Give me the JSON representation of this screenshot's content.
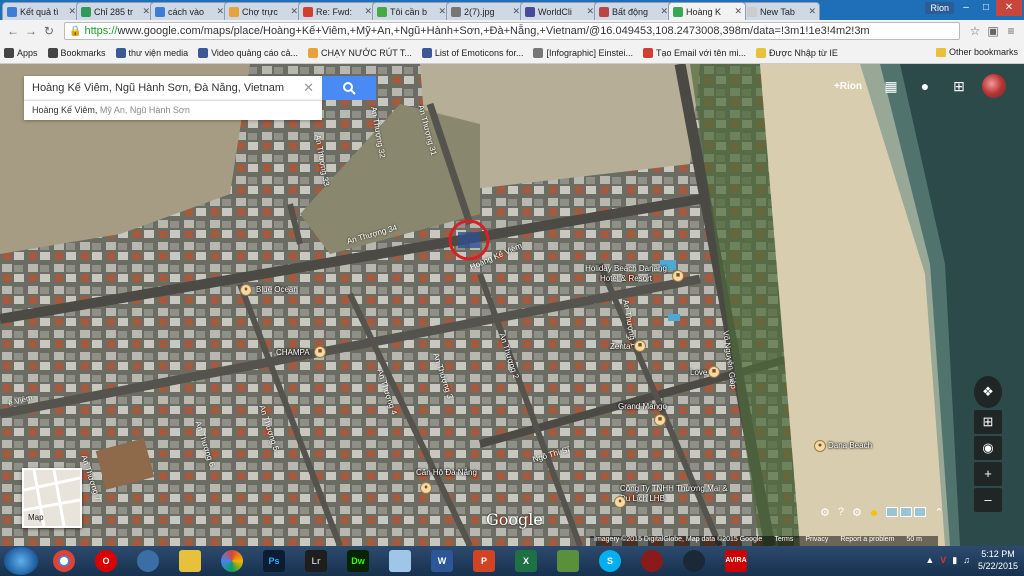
{
  "tabs": [
    {
      "title": "Kết quả tì",
      "color": "#3b7dd8"
    },
    {
      "title": "Chỉ 285 tr",
      "color": "#2f9a5c"
    },
    {
      "title": "cách vào",
      "color": "#3b7dd8"
    },
    {
      "title": "Chợ trực",
      "color": "#e7a23c"
    },
    {
      "title": "Re: Fwd:",
      "color": "#d23f31"
    },
    {
      "title": "Tôi cần b",
      "color": "#44aa44"
    },
    {
      "title": "2(7).jpg",
      "color": "#777777"
    },
    {
      "title": "WorldCli",
      "color": "#4a4a9a"
    },
    {
      "title": "Bất động",
      "color": "#b44"
    },
    {
      "title": "Hoàng K",
      "color": "#34a853",
      "active": true
    },
    {
      "title": "New Tab",
      "color": "#cccccc"
    }
  ],
  "window": {
    "user": "Rion"
  },
  "toolbar": {
    "url_scheme": "https://",
    "url_rest": "www.google.com/maps/place/Hoàng+Kế+Viêm,+Mỹ+An,+Ngũ+Hành+Sơn,+Đà+Nẵng,+Vietnam/@16.049453,108.2473008,398m/data=!3m1!1e3!4m2!3m"
  },
  "bookmarks": [
    {
      "label": "Apps",
      "color": "#444"
    },
    {
      "label": "Bookmarks",
      "color": "#444"
    },
    {
      "label": "thư viện media",
      "color": "#3b5998"
    },
    {
      "label": "Video quảng cáo cả...",
      "color": "#3b5998"
    },
    {
      "label": "CHẠY NƯỚC RÚT T...",
      "color": "#e7a23c"
    },
    {
      "label": "List of Emoticons for...",
      "color": "#3b5998"
    },
    {
      "label": "[Infographic] Einstei...",
      "color": "#777"
    },
    {
      "label": "Tạo Email với tên mi...",
      "color": "#d23f31"
    },
    {
      "label": "Được Nhập từ IE",
      "color": "#e7c13c"
    }
  ],
  "bookmarks_other": "Other bookmarks",
  "maps": {
    "search_value": "Hoàng Kế Viêm, Ngũ Hành Sơn, Đà Nẵng, Vietnam",
    "suggest_main": "Hoàng Kế Viêm, ",
    "suggest_sub": "Mỹ An, Ngũ Hành Sơn",
    "user": "+Rion",
    "minimap_label": "Map",
    "google_logo": "Google",
    "attribution": [
      "Imagery ©2015 DigitalGlobe, Map data ©2015 Google",
      "Terms",
      "Privacy",
      "Report a problem",
      "50 m"
    ],
    "streets": {
      "an_thuong_31": "An Thượng 31",
      "an_thuong_32": "An Thượng 32",
      "an_thuong_33": "An Thượng 33",
      "an_thuong_34": "An Thượng 34",
      "hoang_ke_viem": "Hoàng Kế Viêm",
      "an_thuong_1": "An Thượng 1",
      "an_thuong_2": "An Thượng 2",
      "an_thuong_3": "An Thượng 3",
      "an_thuong_4": "An Thượng 4",
      "an_thuong_5": "An Thượng 5",
      "an_thuong_6": "An Thượng 6",
      "an_thuong_7": "An Thượng 7",
      "ngo_thi_si": "Ngô Thì Sĩ",
      "vo_nguyen_giap": "Võ Nguyên Giáp",
      "viem_left": "ế Viêm"
    },
    "pois": {
      "holiday_beach": "Holiday Beach Danang Hotel & Resort",
      "blue_ocean": "Blue Ocean",
      "champa": "CHAMPA",
      "zenta": "Zenta",
      "love": "Love",
      "grand_mango": "Grand Mango",
      "can_ho": "Căn Hộ Đà Nẵng",
      "cong_ty": "Công Ty TNHH Thương Mại & Du Lịch LHB",
      "dana_beach": "Dana Beach"
    }
  },
  "tray": {
    "time": "5:12 PM",
    "date": "5/22/2015"
  }
}
